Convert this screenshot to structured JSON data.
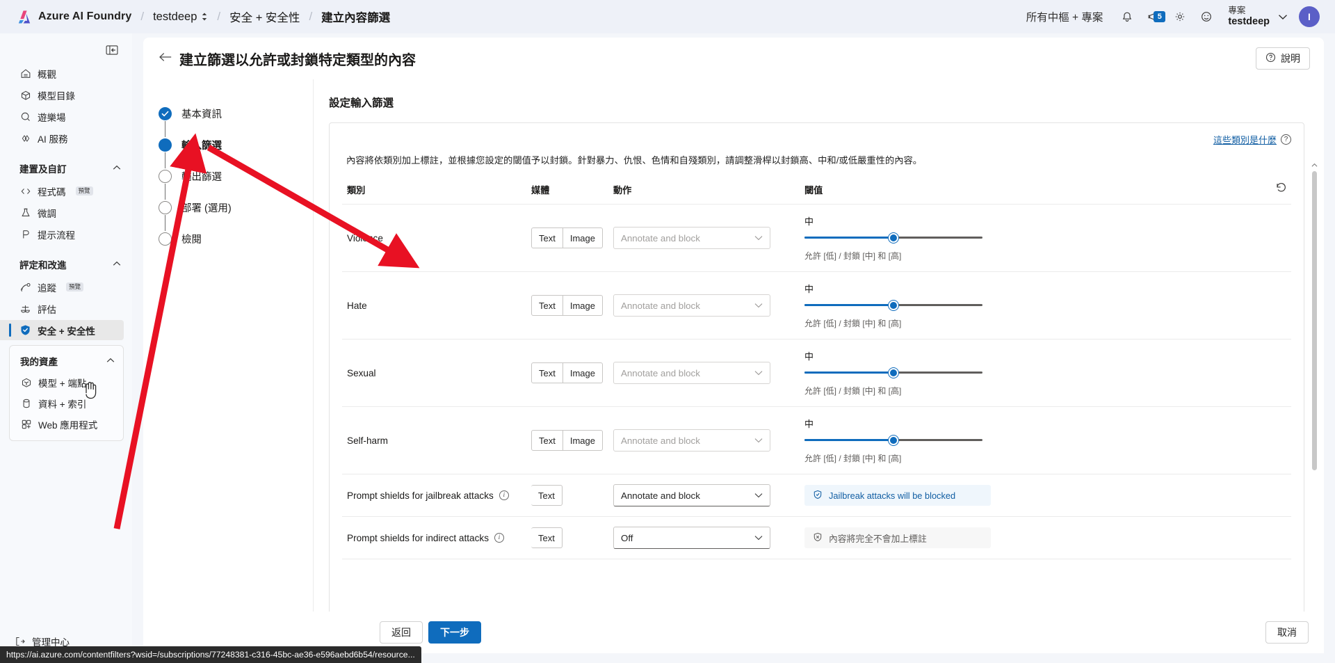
{
  "topbar": {
    "brand": "Azure AI Foundry",
    "breadcrumbs": [
      {
        "label": "testdeep",
        "has_chevron": true,
        "bold": false
      },
      {
        "label": "安全 + 安全性",
        "has_chevron": false,
        "bold": false
      },
      {
        "label": "建立內容篩選",
        "has_chevron": false,
        "bold": true
      }
    ],
    "separator": "/",
    "scope_label": "所有中樞 + 專案",
    "notification_icon": "bell-icon",
    "announcement_icon": "megaphone-icon",
    "announcement_badge": "5",
    "settings_icon": "gear-icon",
    "feedback_icon": "smiley-icon",
    "account": {
      "line1": "專案",
      "line2": "testdeep",
      "avatar_initial": "I"
    }
  },
  "sidebar": {
    "collapse_icon": "panel-collapse-icon",
    "items": [
      {
        "label": "概觀",
        "icon": "home-icon"
      },
      {
        "label": "模型目錄",
        "icon": "cube-icon"
      },
      {
        "label": "遊樂場",
        "icon": "chat-icon"
      },
      {
        "label": "AI 服務",
        "icon": "services-icon"
      }
    ],
    "group_build": {
      "label": "建置及自訂",
      "chevron": "chevron-up-icon",
      "items": [
        {
          "label": "程式碼",
          "icon": "code-icon",
          "badge": "預覽"
        },
        {
          "label": "微調",
          "icon": "flask-icon",
          "badge": ""
        },
        {
          "label": "提示流程",
          "icon": "promptflow-icon",
          "badge": ""
        }
      ]
    },
    "group_assess": {
      "label": "評定和改進",
      "chevron": "chevron-up-icon",
      "items": [
        {
          "label": "追蹤",
          "icon": "trace-icon",
          "badge": "預覽"
        },
        {
          "label": "評估",
          "icon": "scale-icon",
          "badge": ""
        },
        {
          "label": "安全 + 安全性",
          "icon": "shield-icon",
          "badge": "",
          "selected": true
        }
      ]
    },
    "group_assets": {
      "label": "我的資產",
      "chevron": "chevron-up-icon",
      "items": [
        {
          "label": "模型 + 端點",
          "icon": "cube-outline-icon"
        },
        {
          "label": "資料 + 索引",
          "icon": "database-icon"
        },
        {
          "label": "Web 應用程式",
          "icon": "apps-icon"
        }
      ]
    },
    "footer_item": {
      "label": "管理中心",
      "icon": "management-icon"
    }
  },
  "page": {
    "back_icon": "arrow-left-icon",
    "title": "建立篩選以允許或封鎖特定類型的內容",
    "help_label": "說明",
    "help_icon": "question-circle-icon"
  },
  "stepper": {
    "steps": [
      {
        "label": "基本資訊",
        "state": "done"
      },
      {
        "label": "輸入篩選",
        "state": "active"
      },
      {
        "label": "輸出篩選",
        "state": "todo"
      },
      {
        "label": "部署 (選用)",
        "state": "todo"
      },
      {
        "label": "檢閱",
        "state": "todo"
      }
    ]
  },
  "content": {
    "section_title": "設定輸入篩選",
    "categories_link": "這些類別是什麼",
    "categories_link_icon": "question-circle-icon",
    "description": "內容將依類別加上標註，並根據您設定的閾值予以封鎖。針對暴力、仇恨、色情和自殘類別，請調整滑桿以封鎖高、中和/或低嚴重性的內容。",
    "columns": {
      "category": "類別",
      "media": "媒體",
      "action": "動作",
      "threshold": "閾值",
      "reset_icon": "reset-icon"
    },
    "rows": [
      {
        "category": "Violence",
        "media_buttons": [
          "Text",
          "Image"
        ],
        "action_value": "Annotate and block",
        "action_disabled": true,
        "threshold_label": "中",
        "threshold_hint": "允許 [低] / 封鎖 [中] 和 [高]",
        "slider_percent": 50
      },
      {
        "category": "Hate",
        "media_buttons": [
          "Text",
          "Image"
        ],
        "action_value": "Annotate and block",
        "action_disabled": true,
        "threshold_label": "中",
        "threshold_hint": "允許 [低] / 封鎖 [中] 和 [高]",
        "slider_percent": 50
      },
      {
        "category": "Sexual",
        "media_buttons": [
          "Text",
          "Image"
        ],
        "action_value": "Annotate and block",
        "action_disabled": true,
        "threshold_label": "中",
        "threshold_hint": "允許 [低] / 封鎖 [中] 和 [高]",
        "slider_percent": 50
      },
      {
        "category": "Self-harm",
        "media_buttons": [
          "Text",
          "Image"
        ],
        "action_value": "Annotate and block",
        "action_disabled": true,
        "threshold_label": "中",
        "threshold_hint": "允許 [低] / 封鎖 [中] 和 [高]",
        "slider_percent": 50
      }
    ],
    "shield_rows": [
      {
        "category": "Prompt shields for jailbreak attacks",
        "has_info": true,
        "media_buttons": [
          "Text"
        ],
        "action_value": "Annotate and block",
        "action_disabled": false,
        "status_text": "Jailbreak attacks will be blocked",
        "status_icon": "shield-check-icon",
        "status_style": "blue"
      },
      {
        "category": "Prompt shields for indirect attacks",
        "has_info": true,
        "media_buttons": [
          "Text"
        ],
        "action_value": "Off",
        "action_disabled": false,
        "status_text": "內容將完全不會加上標註",
        "status_icon": "shield-off-icon",
        "status_style": "grey"
      }
    ]
  },
  "footer": {
    "back_label": "返回",
    "next_label": "下一步",
    "cancel_label": "取消"
  },
  "status_url": "https://ai.azure.com/contentfilters?wsid=/subscriptions/77248381-c316-45bc-ae36-e596aebd6b54/resource...",
  "colors": {
    "accent": "#0f6cbd",
    "topbar_bg": "#eef1f8",
    "annotation_arrow": "#e81123"
  }
}
